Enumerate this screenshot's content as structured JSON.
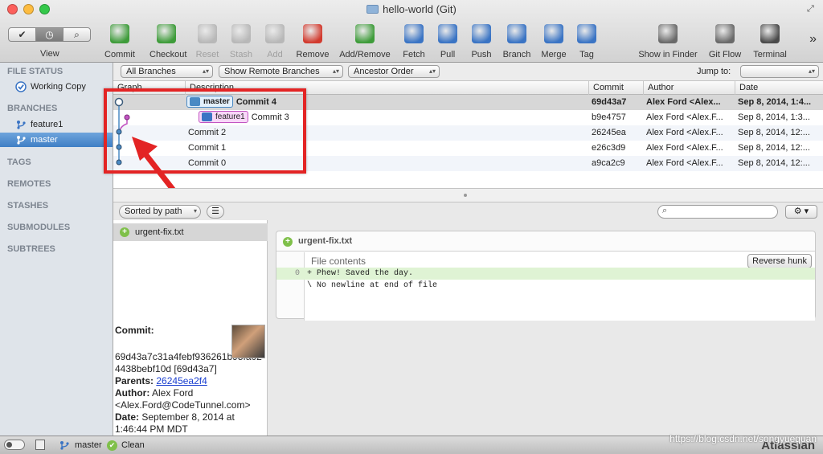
{
  "window": {
    "title": "hello-world (Git)"
  },
  "view": {
    "label": "View",
    "modes": [
      "check",
      "history",
      "search"
    ]
  },
  "toolbar": [
    {
      "label": "Commit",
      "icon": "commit-icon",
      "color": "#3e9c3a",
      "enabled": true
    },
    {
      "label": "Checkout",
      "icon": "checkout-icon",
      "color": "#3e9c3a",
      "enabled": true
    },
    {
      "label": "Reset",
      "icon": "reset-icon",
      "color": "#b8b8b8",
      "enabled": false
    },
    {
      "label": "Stash",
      "icon": "stash-icon",
      "color": "#b8b8b8",
      "enabled": false
    },
    {
      "label": "Add",
      "icon": "add-icon",
      "color": "#b8b8b8",
      "enabled": false
    },
    {
      "label": "Remove",
      "icon": "remove-icon",
      "color": "#d23a2e",
      "enabled": true
    },
    {
      "label": "Add/Remove",
      "icon": "add-remove-icon",
      "color": "#3e9c3a",
      "enabled": true
    },
    {
      "label": "Fetch",
      "icon": "fetch-icon",
      "color": "#3a74c4",
      "enabled": true
    },
    {
      "label": "Pull",
      "icon": "pull-icon",
      "color": "#3a74c4",
      "enabled": true
    },
    {
      "label": "Push",
      "icon": "push-icon",
      "color": "#3a74c4",
      "enabled": true
    },
    {
      "label": "Branch",
      "icon": "branch-icon",
      "color": "#3a74c4",
      "enabled": true
    },
    {
      "label": "Merge",
      "icon": "merge-icon",
      "color": "#3a74c4",
      "enabled": true
    },
    {
      "label": "Tag",
      "icon": "tag-icon",
      "color": "#3a74c4",
      "enabled": true
    },
    {
      "label": "Show in Finder",
      "icon": "finder-icon",
      "color": "#6a6a6a",
      "enabled": true
    },
    {
      "label": "Git Flow",
      "icon": "git-flow-icon",
      "color": "#6a6a6a",
      "enabled": true
    },
    {
      "label": "Terminal",
      "icon": "terminal-icon",
      "color": "#4a4a4a",
      "enabled": true
    }
  ],
  "sidebar": {
    "file_status": "FILE STATUS",
    "working_copy": "Working Copy",
    "branches": "BRANCHES",
    "branch_items": [
      "feature1",
      "master"
    ],
    "tags": "TAGS",
    "remotes": "REMOTES",
    "stashes": "STASHES",
    "submodules": "SUBMODULES",
    "subtrees": "SUBTREES"
  },
  "filters": {
    "branches": "All Branches",
    "remote": "Show Remote Branches",
    "order": "Ancestor Order",
    "jump_label": "Jump to:"
  },
  "columns": {
    "graph": "Graph",
    "description": "Description",
    "commit": "Commit",
    "author": "Author",
    "date": "Date"
  },
  "commits": [
    {
      "tag": "master",
      "message": "Commit 4",
      "hash": "69d43a7",
      "author": "Alex Ford <Alex...",
      "date": "Sep 8, 2014, 1:4..."
    },
    {
      "tag": "feature1",
      "message": "Commit 3",
      "hash": "b9e4757",
      "author": "Alex Ford <Alex.F...",
      "date": "Sep 8, 2014, 1:3..."
    },
    {
      "tag": "",
      "message": "Commit 2",
      "hash": "26245ea",
      "author": "Alex Ford <Alex.F...",
      "date": "Sep 8, 2014, 12:..."
    },
    {
      "tag": "",
      "message": "Commit 1",
      "hash": "e26c3d9",
      "author": "Alex Ford <Alex.F...",
      "date": "Sep 8, 2014, 12:..."
    },
    {
      "tag": "",
      "message": "Commit 0",
      "hash": "a9ca2c9",
      "author": "Alex Ford <Alex.F...",
      "date": "Sep 8, 2014, 12:..."
    }
  ],
  "lower": {
    "sort": "Sorted by path",
    "search_placeholder": "",
    "file": "urgent-fix.txt",
    "diff_file": "urgent-fix.txt",
    "hunk_header": "File contents",
    "reverse_hunk": "Reverse hunk",
    "lines": [
      {
        "num": "0",
        "text": "+ Phew! Saved the day."
      },
      {
        "num": "",
        "text": "\\  No newline at end of file"
      }
    ]
  },
  "commit_info": {
    "commit_label": "Commit:",
    "commit_hash": "69d43a7c31a4febf936261b95fa024438bebf10d [69d43a7]",
    "parents_label": "Parents:",
    "parents_value": "26245ea2f4",
    "author_label": "Author:",
    "author_value": "Alex Ford <Alex.Ford@CodeTunnel.com>",
    "date_label": "Date:",
    "date_value": "September 8, 2014 at 1:46:44 PM MDT"
  },
  "status": {
    "branch": "master",
    "state": "Clean",
    "brand": "Atlassian",
    "watermark": "https://blog.csdn.net/songyuequan"
  },
  "colors": {
    "master": "#4a8ac4",
    "feature": "#c254c2",
    "annotation": "#e32424",
    "selected": "#3f7fc5"
  }
}
